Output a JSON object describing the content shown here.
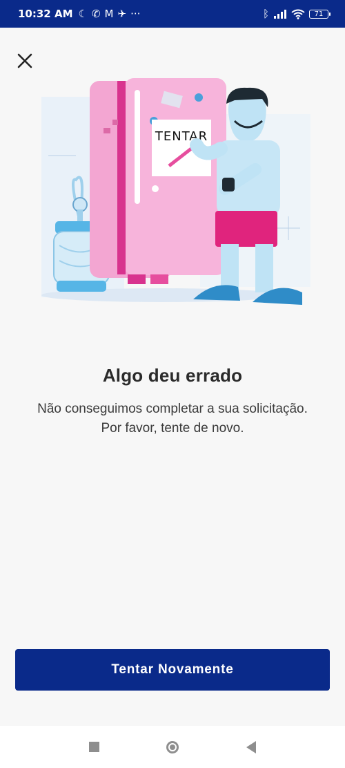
{
  "status_bar": {
    "time": "10:32 AM",
    "left_icons": [
      "moon-icon",
      "whatsapp-icon",
      "gmail-icon",
      "mute-icon",
      "more-dots-icon"
    ],
    "right_icons": [
      "bluetooth-icon",
      "signal-icon",
      "wifi-icon"
    ],
    "battery": "71",
    "background": "#0a2a8a"
  },
  "header": {
    "close_icon": "close-icon"
  },
  "illustration": {
    "note_text": "TENTAR"
  },
  "content": {
    "title": "Algo deu errado",
    "subtitle": "Não conseguimos completar a sua solicitação. Por favor, tente de novo."
  },
  "actions": {
    "retry_label": "Tentar Novamente",
    "color": "#0a2a8a"
  },
  "nav_bar": {
    "icons": [
      "recent-apps-icon",
      "home-icon",
      "back-icon"
    ]
  }
}
